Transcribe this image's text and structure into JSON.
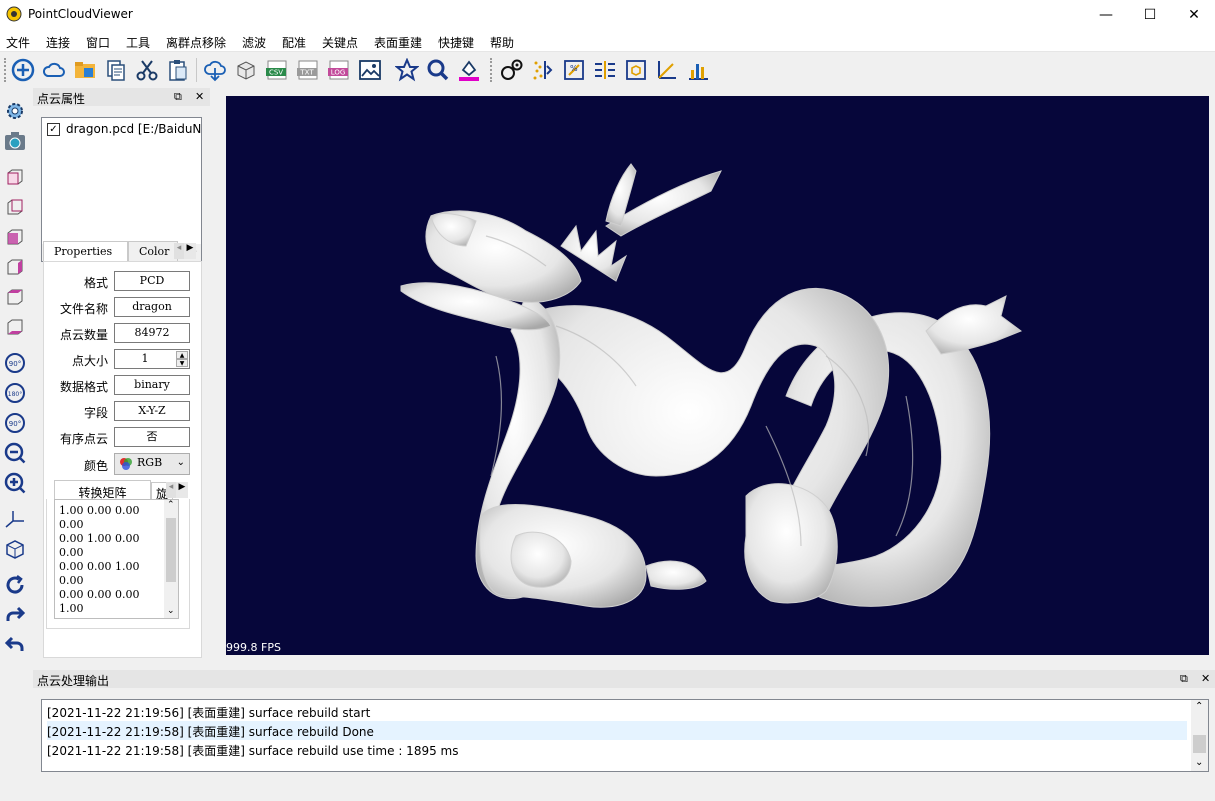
{
  "window": {
    "title": "PointCloudViewer",
    "minimize": "—",
    "maximize": "☐",
    "close": "✕"
  },
  "menubar": [
    "文件",
    "连接",
    "窗口",
    "工具",
    "离群点移除",
    "滤波",
    "配准",
    "关键点",
    "表面重建",
    "快捷键",
    "帮助"
  ],
  "toolbar_icons": [
    "add-icon",
    "cloud-icon",
    "folder-icon",
    "copy-icon",
    "cut-icon",
    "paste-icon",
    "download-icon",
    "box-icon",
    "csv-icon",
    "txt-icon",
    "log-icon",
    "image-icon",
    "star-icon",
    "search-icon",
    "fill-color-icon",
    "keypoint-icon",
    "filter-icon",
    "measure-icon",
    "register-icon",
    "bbox-icon",
    "axis-icon",
    "histogram-icon"
  ],
  "left_toolbar_icons": [
    "settings-icon",
    "camera-icon",
    "view-front-icon",
    "view-back-icon",
    "view-left-icon",
    "view-right-icon",
    "view-top-icon",
    "view-bottom-icon",
    "rotate-90-icon",
    "rotate-180-icon",
    "rotate-neg90-icon",
    "zoom-out-icon",
    "zoom-in-icon",
    "axes-icon",
    "cube-icon",
    "refresh-icon",
    "redo-icon",
    "undo-icon"
  ],
  "properties_dock": {
    "title": "点云属性",
    "float_icon": "⧉",
    "close_icon": "✕",
    "file": {
      "checked": true,
      "check_mark": "✓",
      "name": "dragon.pcd [E:/BaiduN"
    },
    "tabs": [
      "Properties",
      "Color"
    ],
    "fields": [
      {
        "label": "格式",
        "value": "PCD"
      },
      {
        "label": "文件名称",
        "value": "dragon"
      },
      {
        "label": "点云数量",
        "value": "84972"
      },
      {
        "label": "点大小",
        "value": "1"
      },
      {
        "label": "数据格式",
        "value": "binary"
      },
      {
        "label": "字段",
        "value": "X-Y-Z"
      },
      {
        "label": "有序点云",
        "value": "否"
      }
    ],
    "color_label": "颜色",
    "color_value": "RGB",
    "subtabs": [
      "转换矩阵",
      "旋"
    ],
    "matrix_text": "1.00 0.00 0.00\n0.00\n0.00 1.00 0.00\n0.00\n0.00 0.00 1.00\n0.00\n0.00 0.00 0.00\n1.00"
  },
  "viewport": {
    "fps": "999.8 FPS",
    "background": "#06063a"
  },
  "output_dock": {
    "title": "点云处理输出",
    "float_icon": "⧉",
    "close_icon": "✕",
    "lines": [
      "[2021-11-22 21:19:56] [表面重建] surface rebuild start",
      "[2021-11-22 21:19:58] [表面重建] surface rebuild Done",
      "[2021-11-22 21:19:58] [表面重建] surface rebuild use time : 1895 ms"
    ],
    "selected_index": 1
  },
  "colors": {
    "accent_blue": "#1a5fb4",
    "viewport_bg": "#06063a",
    "selection": "#e5f3ff"
  }
}
